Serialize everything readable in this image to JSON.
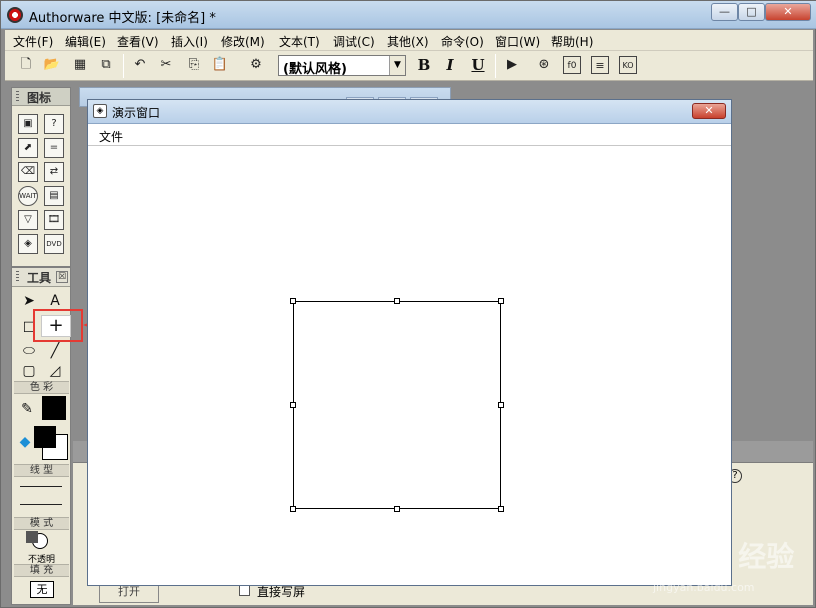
{
  "app": {
    "title": "Authorware 中文版: [未命名] *",
    "min_glyph": "—",
    "max_glyph": "□",
    "close_glyph": "✕"
  },
  "menu": [
    "文件(F)",
    "编辑(E)",
    "查看(V)",
    "插入(I)",
    "修改(M)",
    "文本(T)",
    "调试(C)",
    "其他(X)",
    "命令(O)",
    "窗口(W)",
    "帮助(H)"
  ],
  "toolbar": {
    "style_value": "(默认风格)",
    "bold": "B",
    "italic": "I",
    "underline": "U",
    "buttons": [
      "new-icon",
      "open-icon",
      "save-all-icon",
      "import-icon",
      "undo-icon",
      "cut-icon",
      "copy-icon",
      "paste-icon",
      "find-icon",
      "run-icon",
      "control-panel-icon",
      "functions-icon",
      "variables-icon",
      "knowledge-objects-icon"
    ]
  },
  "icons_palette": {
    "title": "图标"
  },
  "tools_palette": {
    "title": "工具",
    "close_glyph": "☒",
    "color_label": "色 彩",
    "line_label": "线 型",
    "mode_label": "模 式",
    "mode_value": "不透明",
    "fill_label": "填 充",
    "fill_value": "无"
  },
  "presentation_window": {
    "title": "演示窗口",
    "menu_file": "文件",
    "close_glyph": "✕"
  },
  "properties": {
    "checkbox_label": "直接写屏",
    "open_button": "打开",
    "help_glyph": "?"
  },
  "watermark": {
    "text": "Bai du 经验",
    "sub": "jingyan.baidu.com"
  },
  "colors": {
    "highlight": "#e53a33",
    "titlebar": "#b9d0e9"
  }
}
